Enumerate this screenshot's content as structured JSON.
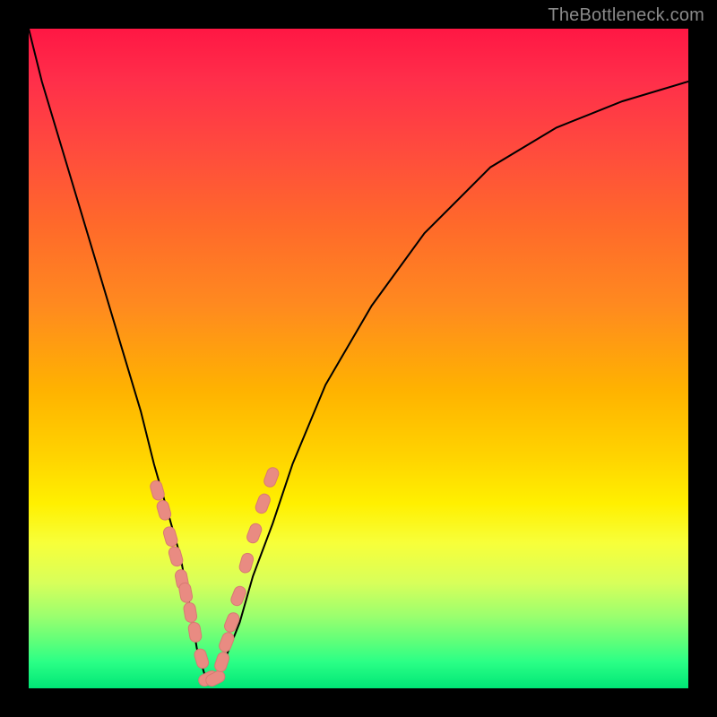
{
  "watermark": {
    "text": "TheBottleneck.com"
  },
  "colors": {
    "frame": "#000000",
    "curve": "#000000",
    "marker_fill": "#e98b82",
    "marker_stroke": "#d87a72",
    "gradient": [
      "#ff1744",
      "#ff4a3e",
      "#ff8a1f",
      "#ffd400",
      "#fff000",
      "#9cff6e",
      "#00e676"
    ]
  },
  "chart_data": {
    "type": "line",
    "title": "",
    "xlabel": "",
    "ylabel": "",
    "xlim": [
      0,
      1
    ],
    "ylim": [
      0,
      1
    ],
    "notes": "V-shaped bottleneck curve. y is bottleneck magnitude (0 = no bottleneck / green, 1 = severe / red). Minimum at x ≈ 0.27.",
    "series": [
      {
        "name": "bottleneck-curve",
        "x": [
          0.0,
          0.02,
          0.05,
          0.08,
          0.11,
          0.14,
          0.17,
          0.19,
          0.21,
          0.23,
          0.245,
          0.255,
          0.27,
          0.29,
          0.3,
          0.32,
          0.34,
          0.37,
          0.4,
          0.45,
          0.52,
          0.6,
          0.7,
          0.8,
          0.9,
          1.0
        ],
        "values": [
          1.0,
          0.92,
          0.82,
          0.72,
          0.62,
          0.52,
          0.42,
          0.34,
          0.27,
          0.2,
          0.12,
          0.06,
          0.01,
          0.02,
          0.05,
          0.1,
          0.17,
          0.25,
          0.34,
          0.46,
          0.58,
          0.69,
          0.79,
          0.85,
          0.89,
          0.92
        ]
      }
    ],
    "markers": {
      "name": "highlight-cluster",
      "note": "Pill/capsule shaped salmon markers clustered around the curve minimum on both branches.",
      "x": [
        0.195,
        0.205,
        0.215,
        0.223,
        0.232,
        0.238,
        0.245,
        0.252,
        0.262,
        0.272,
        0.283,
        0.293,
        0.3,
        0.308,
        0.318,
        0.33,
        0.342,
        0.355,
        0.368
      ],
      "values": [
        0.3,
        0.27,
        0.23,
        0.2,
        0.165,
        0.145,
        0.115,
        0.085,
        0.045,
        0.015,
        0.015,
        0.04,
        0.07,
        0.1,
        0.14,
        0.19,
        0.235,
        0.28,
        0.32
      ]
    }
  }
}
